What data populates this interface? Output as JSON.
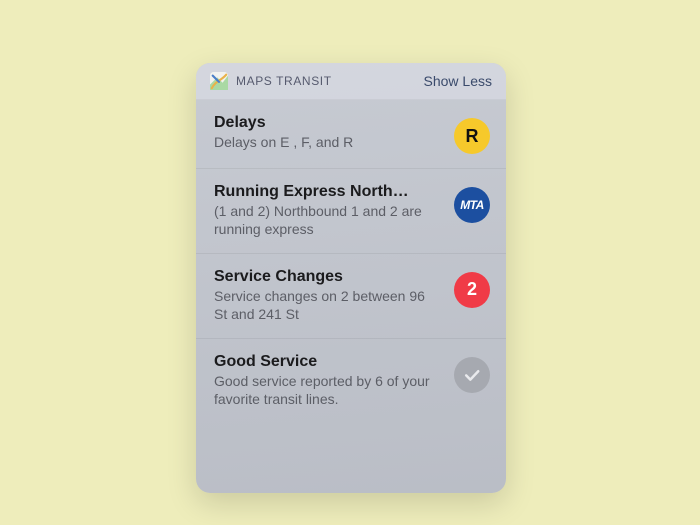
{
  "header": {
    "title": "MAPS TRANSIT",
    "action": "Show Less"
  },
  "rows": [
    {
      "title": "Delays",
      "sub": "Delays on E , F,  and R",
      "badge": {
        "text": "R",
        "kind": "r",
        "name": "transit-line-r-badge"
      }
    },
    {
      "title": "Running Express North…",
      "sub": "(1 and 2) Northbound 1 and 2 are running express",
      "badge": {
        "text": "MTA",
        "kind": "mta",
        "name": "mta-logo-badge"
      }
    },
    {
      "title": "Service Changes",
      "sub": "Service changes on 2 between 96 St and 241 St",
      "badge": {
        "text": "2",
        "kind": "2",
        "name": "transit-line-2-badge"
      }
    },
    {
      "title": "Good Service",
      "sub": "Good service reported by 6 of your favorite transit lines.",
      "badge": {
        "text": "",
        "kind": "check",
        "name": "good-service-check-badge"
      }
    }
  ]
}
